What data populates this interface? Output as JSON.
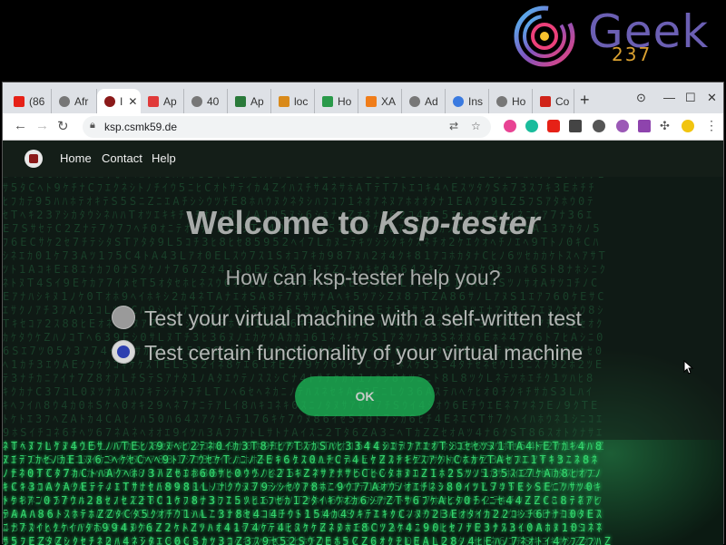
{
  "logo": {
    "text": "Geek",
    "number": "237"
  },
  "browser": {
    "tabs": [
      {
        "label": "(86",
        "favicon": "youtube-icon",
        "color": "#e62117"
      },
      {
        "label": "Afr",
        "favicon": "globe-icon",
        "color": "#777777"
      },
      {
        "label": "I",
        "favicon": "ksp-icon",
        "color": "#8b1a1a",
        "active": true
      },
      {
        "label": "Ap",
        "favicon": "app-icon",
        "color": "#e03a3a"
      },
      {
        "label": "40",
        "favicon": "globe-icon",
        "color": "#777777"
      },
      {
        "label": "Ap",
        "favicon": "app-icon",
        "color": "#2a7a3a"
      },
      {
        "label": "loc",
        "favicon": "local-icon",
        "color": "#d98a1a"
      },
      {
        "label": "Ho",
        "favicon": "bt-icon",
        "color": "#2a9a4a"
      },
      {
        "label": "XA",
        "favicon": "xampp-icon",
        "color": "#f07d1a"
      },
      {
        "label": "Ad",
        "favicon": "globe-icon",
        "color": "#777777"
      },
      {
        "label": "Ins",
        "favicon": "install-icon",
        "color": "#3a7ae0"
      },
      {
        "label": "Ho",
        "favicon": "globe-icon",
        "color": "#777777"
      },
      {
        "label": "Co",
        "favicon": "co-icon",
        "color": "#d0241a"
      }
    ],
    "new_tab": "+",
    "url": "ksp.csmk59.de"
  },
  "page": {
    "nav": {
      "home": "Home",
      "contact": "Contact",
      "help": "Help"
    },
    "title_prefix": "Welcome to ",
    "title_brand": "Ksp-tester",
    "question": "How can ksp-tester help you?",
    "options": [
      {
        "label": "Test your virtual machine with a self-written test",
        "checked": false
      },
      {
        "label": "Test certain functionality of your virtual machine",
        "checked": true
      }
    ],
    "ok_button": "OK"
  },
  "colors": {
    "accent": "#1ebe5a",
    "radio_checked": "#2d3fb0",
    "matrix_green": "#36d46e"
  }
}
